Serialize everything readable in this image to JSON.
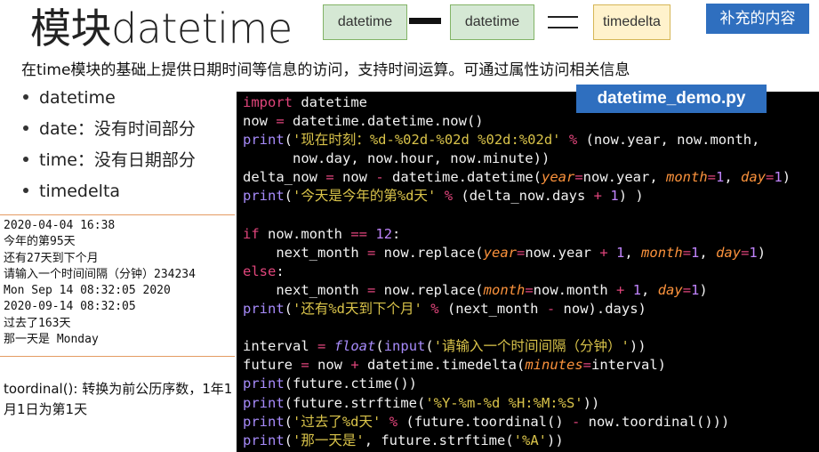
{
  "title": "模块datetime",
  "diagram": {
    "box1": "datetime",
    "box2": "datetime",
    "box3": "timedelta",
    "badge": "补充的内容"
  },
  "subtitle": "在time模块的基础上提供日期时间等信息的访问，支持时间运算。可通过属性访问相关信息",
  "bullets": [
    "datetime",
    "date：没有时间部分",
    "time：没有日期部分",
    "timedelta"
  ],
  "output_lines": [
    "2020-04-04 16:38",
    "今年的第95天",
    "还有27天到下个月",
    "请输入一个时间间隔（分钟）234234",
    "Mon Sep 14 08:32:05 2020",
    "2020-09-14 08:32:05",
    "过去了163天",
    "那一天是 Monday"
  ],
  "toordinal_note": "toordinal(): 转换为前公历序数，1年1月1日为第1天",
  "code": {
    "filename": "datetime_demo.py",
    "lines": [
      "import datetime",
      "now = datetime.datetime.now()",
      "print('现在时刻：%d-%02d-%02d %02d:%02d' % (now.year, now.month,",
      "      now.day, now.hour, now.minute))",
      "delta_now = now - datetime.datetime(year=now.year, month=1, day=1)",
      "print('今天是今年的第%d天' % (delta_now.days + 1) )",
      "",
      "if now.month == 12:",
      "    next_month = now.replace(year=now.year + 1, month=1, day=1)",
      "else:",
      "    next_month = now.replace(month=now.month + 1, day=1)",
      "print('还有%d天到下个月' % (next_month - now).days)",
      "",
      "interval = float(input('请输入一个时间间隔（分钟）'))",
      "future = now + datetime.timedelta(minutes=interval)",
      "print(future.ctime())",
      "print(future.strftime('%Y-%m-%d %H:%M:%S'))",
      "print('过去了%d天' % (future.toordinal() - now.toordinal()))",
      "print('那一天是', future.strftime('%A'))"
    ]
  },
  "colors": {
    "green_box": "#d5e8d4",
    "yellow_box": "#fff2cc",
    "badge_blue": "#2f6fbf",
    "code_bg": "#000000",
    "rule_orange": "#e49b63"
  }
}
